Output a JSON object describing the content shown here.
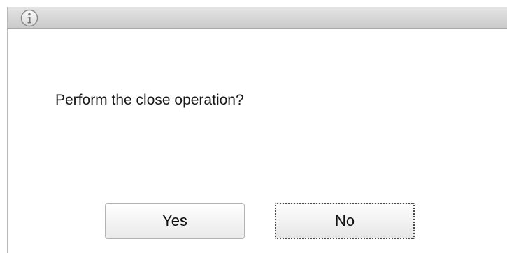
{
  "window": {
    "title_icon": "info-icon"
  },
  "dialog": {
    "message": "Perform the close operation?"
  },
  "buttons": {
    "yes_label": "Yes",
    "no_label": "No"
  }
}
